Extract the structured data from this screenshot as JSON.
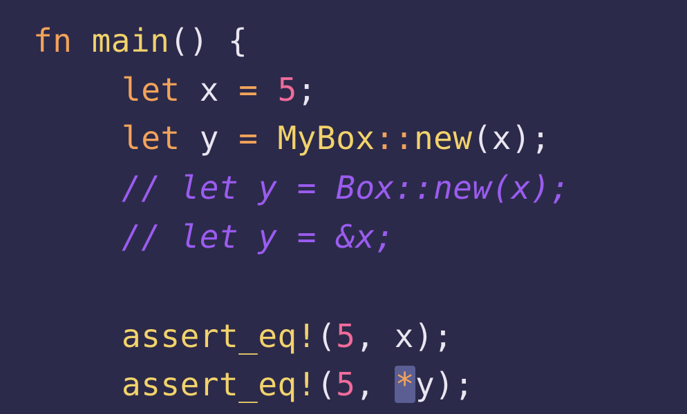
{
  "code": {
    "line1": {
      "kw": "fn",
      "name": "main",
      "parens": "()",
      "brace": "{"
    },
    "line2": {
      "kw": "let",
      "var": "x",
      "eq": "=",
      "num": "5",
      "semi": ";"
    },
    "line3": {
      "kw": "let",
      "var": "y",
      "eq": "=",
      "type": "MyBox",
      "path": "::",
      "fn": "new",
      "open": "(",
      "arg": "x",
      "close": ")",
      "semi": ";"
    },
    "line4": {
      "comment": "// let y = Box::new(x);"
    },
    "line5": {
      "comment": "// let y = &x;"
    },
    "line7": {
      "macro": "assert_eq!",
      "open": "(",
      "num": "5",
      "comma": ",",
      "arg": "x",
      "close": ")",
      "semi": ";"
    },
    "line8": {
      "macro": "assert_eq!",
      "open": "(",
      "num": "5",
      "comma": ",",
      "deref": "*",
      "arg": "y",
      "close": ")",
      "semi": ";"
    }
  },
  "colors": {
    "background": "#2c2a4a",
    "keyword": "#f2a35a",
    "function": "#f2d36b",
    "number": "#f06c9b",
    "comment": "#9b5cf0",
    "text": "#e9e6f2",
    "selection": "#5a5e93"
  }
}
